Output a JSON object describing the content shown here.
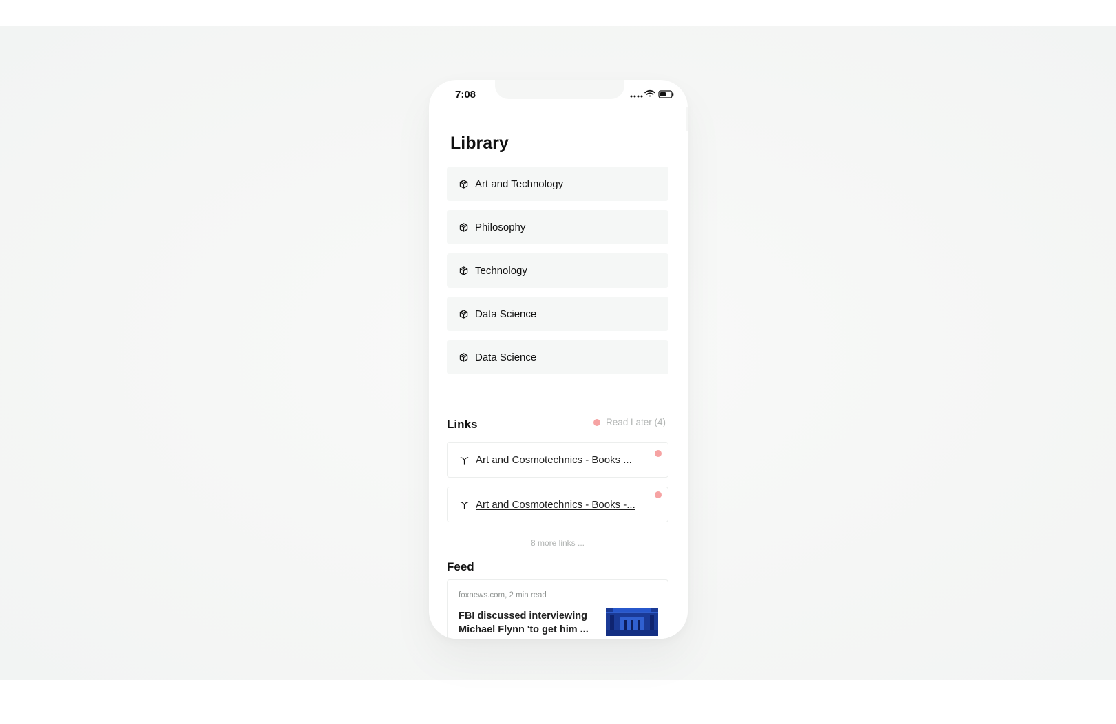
{
  "status_bar": {
    "time": "7:08",
    "icons": [
      "signal-icon",
      "wifi-icon",
      "battery-icon"
    ]
  },
  "library": {
    "title": "Library",
    "items": [
      {
        "label": "Art and Technology",
        "icon": "cube-icon"
      },
      {
        "label": "Philosophy",
        "icon": "cube-icon"
      },
      {
        "label": "Technology",
        "icon": "cube-icon"
      },
      {
        "label": "Data Science",
        "icon": "cube-icon"
      },
      {
        "label": "Data Science",
        "icon": "cube-icon"
      }
    ]
  },
  "links": {
    "title": "Links",
    "read_later_label": "Read Later (4)",
    "items": [
      {
        "label": "Art and Cosmotechnics - Books ...",
        "icon": "link-branch-icon"
      },
      {
        "label": "Art and Cosmotechnics - Books -...",
        "icon": "link-branch-icon"
      }
    ],
    "more_label": "8 more links ..."
  },
  "feed": {
    "title": "Feed",
    "items": [
      {
        "meta": "foxnews.com, 2 min read",
        "headline": "FBI discussed interviewing Michael Flynn 'to get him ..."
      }
    ]
  },
  "colors": {
    "accent_dot": "#f6a3a3",
    "card_background": "#f5f7f6",
    "page_background": "#f5f6f5",
    "thumbnail_blue": "#1f4ab8"
  }
}
